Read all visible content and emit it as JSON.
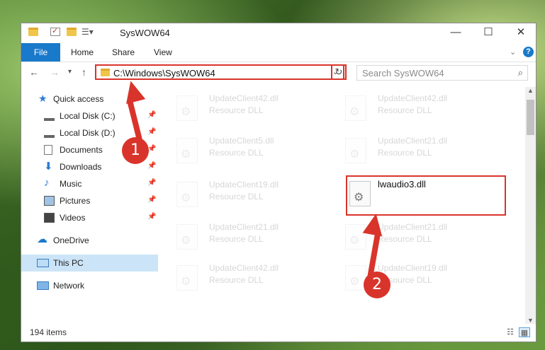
{
  "window": {
    "title": "SysWOW64"
  },
  "controls": {
    "minimize": "—",
    "maximize": "☐",
    "close": "✕"
  },
  "ribbon": {
    "file": "File",
    "tabs": [
      "Home",
      "Share",
      "View"
    ]
  },
  "address": {
    "path": "C:\\Windows\\SysWOW64"
  },
  "search": {
    "placeholder": "Search SysWOW64"
  },
  "nav": {
    "quick_access": "Quick access",
    "items": [
      {
        "label": "Local Disk (C:)",
        "icon": "drive-icon"
      },
      {
        "label": "Local Disk (D:)",
        "icon": "drive-icon"
      },
      {
        "label": "Documents",
        "icon": "documents-icon"
      },
      {
        "label": "Downloads",
        "icon": "downloads-icon"
      },
      {
        "label": "Music",
        "icon": "music-icon"
      },
      {
        "label": "Pictures",
        "icon": "pictures-icon"
      },
      {
        "label": "Videos",
        "icon": "videos-icon"
      }
    ],
    "onedrive": "OneDrive",
    "this_pc": "This PC",
    "network": "Network"
  },
  "files": [
    {
      "name": "UpdateClient42.dll",
      "type": "Resource DLL"
    },
    {
      "name": "UpdateClient42.dll",
      "type": "Resource DLL"
    },
    {
      "name": "UpdateClient5.dll",
      "type": "Resource DLL"
    },
    {
      "name": "UpdateClient21.dll",
      "type": "Resource DLL"
    },
    {
      "name": "UpdateClient19.dll",
      "type": "Resource DLL"
    },
    {
      "name": "lwaudio3.dll",
      "type": ""
    },
    {
      "name": "UpdateClient21.dll",
      "type": "Resource DLL"
    },
    {
      "name": "UpdateClient21.dll",
      "type": "Resource DLL"
    },
    {
      "name": "UpdateClient42.dll",
      "type": "Resource DLL"
    },
    {
      "name": "UpdateClient19.dll",
      "type": "Resource DLL"
    }
  ],
  "status": {
    "items": "194 items"
  },
  "annotations": {
    "step1": "1",
    "step2": "2"
  },
  "colors": {
    "accent": "#1979ca",
    "highlight": "#d9342b",
    "selection": "#cce4f7"
  }
}
